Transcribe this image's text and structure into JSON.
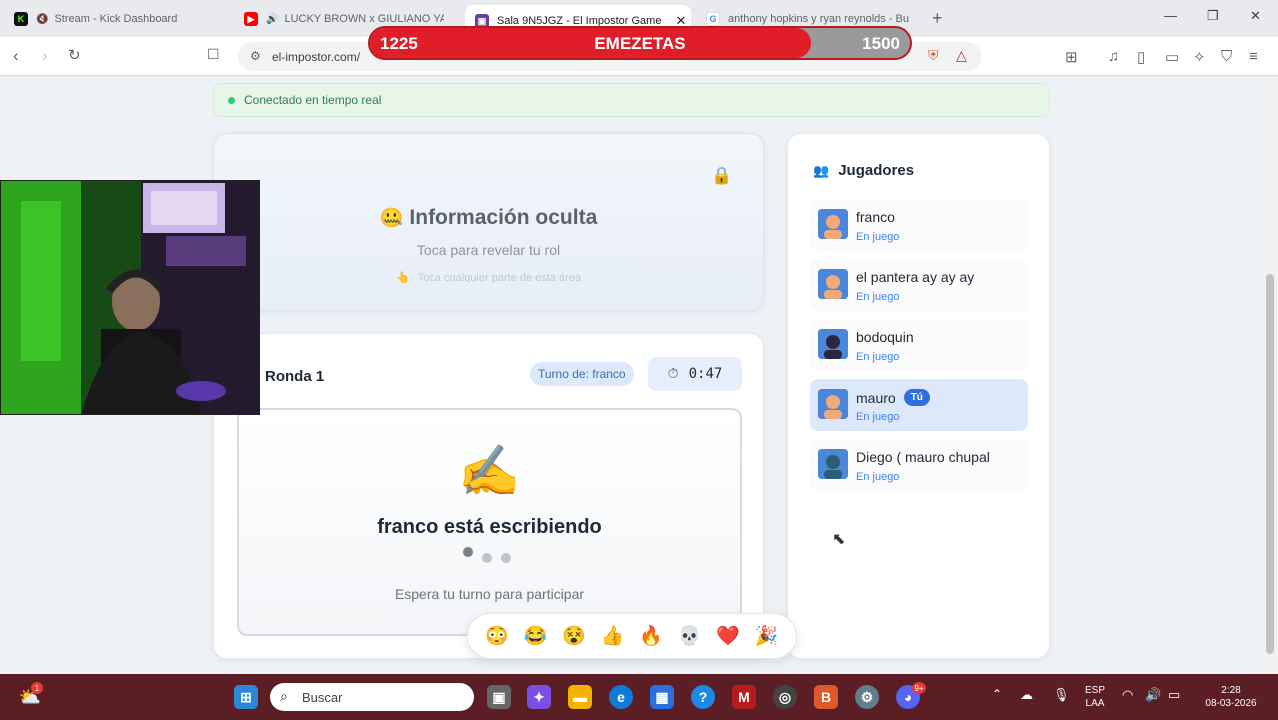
{
  "browser": {
    "tabs": [
      {
        "title": "Stream - Kick Dashboard",
        "favicon": "kick-icon",
        "color": "#53fc18"
      },
      {
        "title": "LUCKY BROWN x GIULIANO YAN",
        "favicon": "youtube-icon",
        "color": "#ff0000"
      },
      {
        "title": "Sala 9N5JGZ - El Impostor Game",
        "favicon": "impostor-icon",
        "color": "#6b3fa0",
        "active": true
      },
      {
        "title": "anthony hopkins y ryan reynolds - Bu",
        "favicon": "google-icon",
        "color": "#4285f4"
      }
    ],
    "url": "el-impostor.com/"
  },
  "overlay": {
    "left_value": "1225",
    "label": "EMEZETAS",
    "right_value": "1500",
    "progress": 0.8167
  },
  "page": {
    "connection_status": "Conectado en tiempo real",
    "hidden_info": {
      "title": "Información oculta",
      "subtitle": "Toca para revelar tu rol",
      "hint": "Toca cualquier parte de esta área"
    },
    "round": {
      "title": "Ronda 1",
      "turn": "Turno de: franco",
      "timer": "0:47",
      "writing": "franco está escribiendo",
      "wait": "Espera tu turno para participar"
    },
    "reactions": [
      "😳",
      "😂",
      "😵",
      "👍",
      "🔥",
      "💀",
      "❤️",
      "🎉"
    ],
    "players": {
      "heading": "Jugadores",
      "list": [
        {
          "name": "franco",
          "status": "En juego",
          "avatar": "#f2a97a"
        },
        {
          "name": "el pantera ay ay ay",
          "status": "En juego",
          "avatar": "#f2a97a"
        },
        {
          "name": "bodoquin",
          "status": "En juego",
          "avatar": "#2d2640"
        },
        {
          "name": "mauro",
          "status": "En juego",
          "avatar": "#f2a97a",
          "me": true,
          "badge": "Tú"
        },
        {
          "name": "Diego ( mauro chupal",
          "status": "En juego",
          "avatar": "#2b5d73"
        }
      ]
    }
  },
  "taskbar": {
    "search_placeholder": "Buscar",
    "lang_top": "ESP",
    "lang_bottom": "LAA",
    "time": "2:28",
    "date": "08-03-2026",
    "weather_badge": "1",
    "discord_badge": "9+"
  }
}
